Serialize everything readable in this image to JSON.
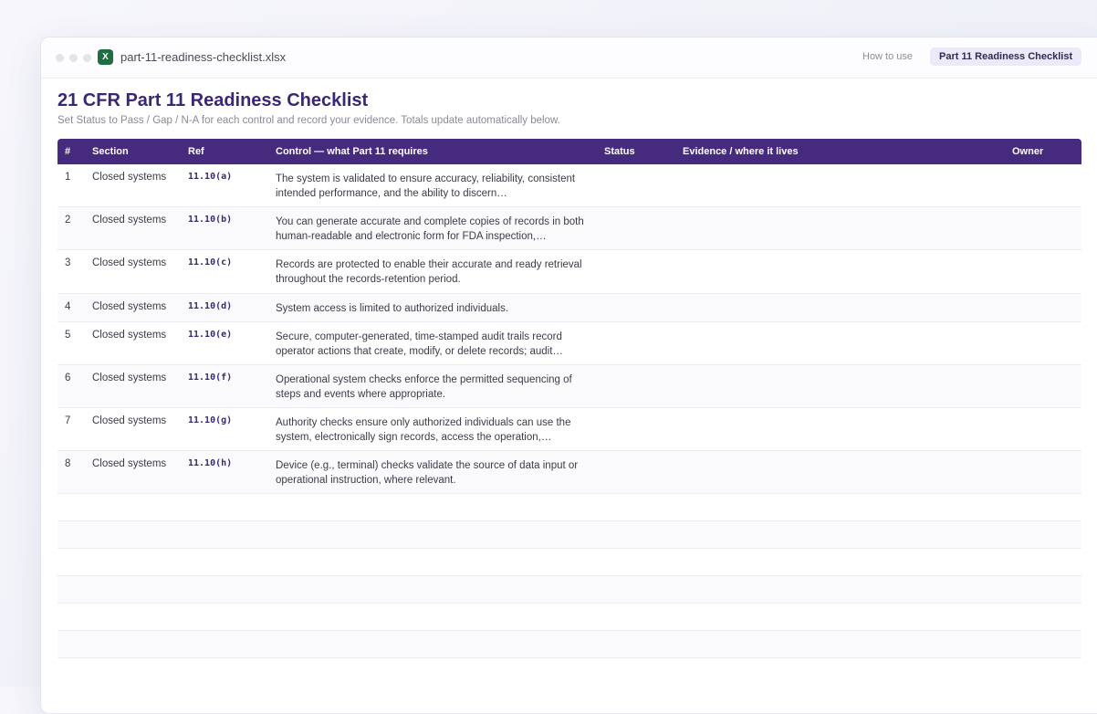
{
  "window": {
    "file_icon_letter": "X",
    "file_name": "part-11-readiness-checklist.xlsx",
    "tabs": [
      {
        "label": "How to use",
        "active": false
      },
      {
        "label": "Part 11 Readiness Checklist",
        "active": true
      }
    ]
  },
  "sheet": {
    "title": "21 CFR Part 11 Readiness Checklist",
    "subtitle": "Set Status to Pass / Gap / N-A for each control and record your evidence. Totals update automatically below."
  },
  "table": {
    "headers": {
      "num": "#",
      "section": "Section",
      "ref": "Ref",
      "control": "Control — what Part 11 requires",
      "status": "Status",
      "evidence": "Evidence / where it lives",
      "owner": "Owner"
    },
    "rows": [
      {
        "num": "1",
        "section": "Closed systems",
        "ref": "11.10(a)",
        "control": "The system is validated to ensure accuracy, reliability, consistent intended performance, and the ability to discern…"
      },
      {
        "num": "2",
        "section": "Closed systems",
        "ref": "11.10(b)",
        "control": "You can generate accurate and complete copies of records in both human-readable and electronic form for FDA inspection,…"
      },
      {
        "num": "3",
        "section": "Closed systems",
        "ref": "11.10(c)",
        "control": "Records are protected to enable their accurate and ready retrieval throughout the records-retention period."
      },
      {
        "num": "4",
        "section": "Closed systems",
        "ref": "11.10(d)",
        "control": "System access is limited to authorized individuals."
      },
      {
        "num": "5",
        "section": "Closed systems",
        "ref": "11.10(e)",
        "control": "Secure, computer-generated, time-stamped audit trails record operator actions that create, modify, or delete records; audit…"
      },
      {
        "num": "6",
        "section": "Closed systems",
        "ref": "11.10(f)",
        "control": "Operational system checks enforce the permitted sequencing of steps and events where appropriate."
      },
      {
        "num": "7",
        "section": "Closed systems",
        "ref": "11.10(g)",
        "control": "Authority checks ensure only authorized individuals can use the system, electronically sign records, access the operation,…"
      },
      {
        "num": "8",
        "section": "Closed systems",
        "ref": "11.10(h)",
        "control": "Device (e.g., terminal) checks validate the source of data input or operational instruction, where relevant."
      }
    ]
  }
}
